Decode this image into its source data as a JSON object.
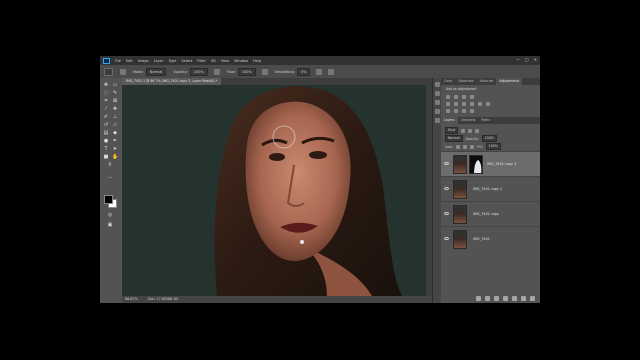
{
  "menu": {
    "items": [
      "File",
      "Edit",
      "Image",
      "Layer",
      "Type",
      "Select",
      "Filter",
      "3D",
      "View",
      "Window",
      "Help"
    ],
    "window_buttons": [
      "—",
      "□",
      "✕"
    ]
  },
  "options": {
    "mode_label": "Mode:",
    "mode_value": "Normal",
    "opacity_label": "Opacity:",
    "opacity_value": "100%",
    "flow_label": "Flow:",
    "flow_value": "100%",
    "smoothing_label": "Smoothing:",
    "smoothing_value": "0%"
  },
  "document": {
    "tab_title": "IMG_7401-1 @ 66.7% (IMG_7401 copy 3, Layer Mask/8) *",
    "zoom": "66.67%",
    "info": "Doc: 17.6M/66.1M"
  },
  "panels": {
    "top_tabs": [
      "Color",
      "Swatches",
      "Libraries",
      "Adjustments"
    ],
    "adjustments_title": "Add an adjustment",
    "layer_tabs": [
      "Layers",
      "Channels",
      "Paths"
    ],
    "filter_value": "Kind",
    "blend_mode": "Normal",
    "opacity_label": "Opacity:",
    "opacity_value": "100%",
    "lock_label": "Lock:",
    "fill_label": "Fill:",
    "fill_value": "100%"
  },
  "layers": [
    {
      "name": "IMG_7401 copy 3",
      "has_mask": true,
      "selected": true
    },
    {
      "name": "IMG_7401 copy 2",
      "has_mask": false,
      "selected": false
    },
    {
      "name": "IMG_7401 copy",
      "has_mask": false,
      "selected": false
    },
    {
      "name": "IMG_7401",
      "has_mask": false,
      "selected": false
    }
  ],
  "colors": {
    "foreground": "#000000",
    "background": "#ffffff",
    "accent": "#31a8ff"
  }
}
